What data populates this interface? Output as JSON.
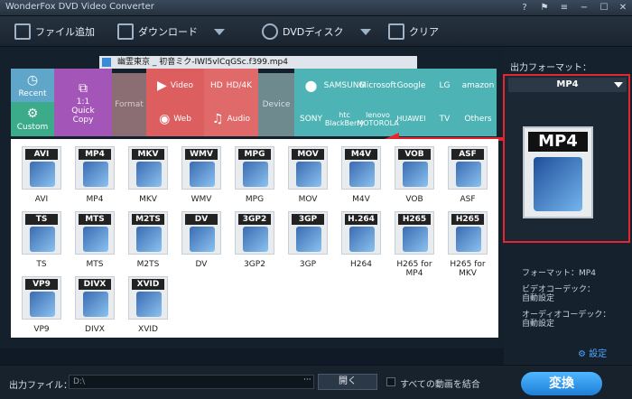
{
  "window": {
    "title": "WonderFox DVD Video Converter"
  },
  "toolbar": {
    "add_files": "ファイル追加",
    "download": "ダウンロード",
    "dvd_disc": "DVDディスク",
    "clear": "クリア"
  },
  "file_item": {
    "name": "幽霊東京 _ 初音ミク-IWl5vlCqGSc.f399.mp4"
  },
  "categories": {
    "recent": "Recent",
    "custom": "Custom",
    "quick_copy": "1:1\nQuick\nCopy",
    "format": "Format",
    "video": "Video",
    "hd4k": "HD/4K",
    "web": "Web",
    "audio": "Audio",
    "device": "Device"
  },
  "brands": [
    "",
    "SAMSUNG",
    "Microsoft",
    "Google",
    "LG",
    "amazon",
    "SONY",
    "htc BlackBerry",
    "lenovo MOTOROLA",
    "HUAWEI",
    "TV",
    "Others"
  ],
  "formats": [
    {
      "label": "AVI",
      "name": "AVI"
    },
    {
      "label": "MP4",
      "name": "MP4"
    },
    {
      "label": "MKV",
      "name": "MKV"
    },
    {
      "label": "WMV",
      "name": "WMV"
    },
    {
      "label": "MPG",
      "name": "MPG"
    },
    {
      "label": "MOV",
      "name": "MOV"
    },
    {
      "label": "M4V",
      "name": "M4V"
    },
    {
      "label": "VOB",
      "name": "VOB"
    },
    {
      "label": "ASF",
      "name": "ASF"
    },
    {
      "label": "TS",
      "name": "TS"
    },
    {
      "label": "MTS",
      "name": "MTS"
    },
    {
      "label": "M2TS",
      "name": "M2TS"
    },
    {
      "label": "DV",
      "name": "DV"
    },
    {
      "label": "3GP2",
      "name": "3GP2"
    },
    {
      "label": "3GP",
      "name": "3GP"
    },
    {
      "label": "H.264",
      "name": "H264"
    },
    {
      "label": "H265",
      "name": "H265 for MP4"
    },
    {
      "label": "H265",
      "name": "H265 for MKV"
    },
    {
      "label": "VP9",
      "name": "VP9"
    },
    {
      "label": "DIVX",
      "name": "DIVX"
    },
    {
      "label": "XVID",
      "name": "XVID"
    }
  ],
  "output": {
    "label": "出力フォーマット：",
    "selected": "MP4",
    "format_line": "フォーマット：MP4",
    "video_codec_label": "ビデオコーデック：",
    "video_codec_value": "自動設定",
    "audio_codec_label": "オーディオコーデック：",
    "audio_codec_value": "自動設定",
    "settings": "設定"
  },
  "bottom": {
    "output_file_label": "出力ファイル：",
    "path": "D:\\",
    "browse": "···",
    "open": "開く",
    "merge_label": "すべての動画を結合",
    "convert": "変換"
  }
}
